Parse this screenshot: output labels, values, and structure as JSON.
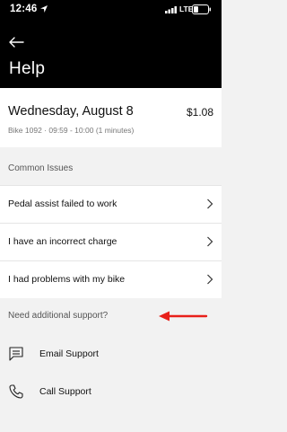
{
  "status_bar": {
    "time": "12:46",
    "network": "LTE"
  },
  "header": {
    "title": "Help"
  },
  "trip": {
    "date": "Wednesday, August 8",
    "price": "$1.08",
    "details": "Bike 1092  ·  09:59 - 10:00 (1 minutes)"
  },
  "common_issues": {
    "label": "Common Issues",
    "items": [
      {
        "label": "Pedal assist failed to work"
      },
      {
        "label": "I have an incorrect charge"
      },
      {
        "label": "I had problems with my bike"
      }
    ]
  },
  "additional_support": {
    "label": "Need additional support?",
    "items": [
      {
        "label": "Email Support",
        "icon": "chat-icon"
      },
      {
        "label": "Call Support",
        "icon": "phone-icon"
      }
    ]
  },
  "colors": {
    "header_bg": "#000000",
    "annotation_arrow": "#e8201a"
  }
}
